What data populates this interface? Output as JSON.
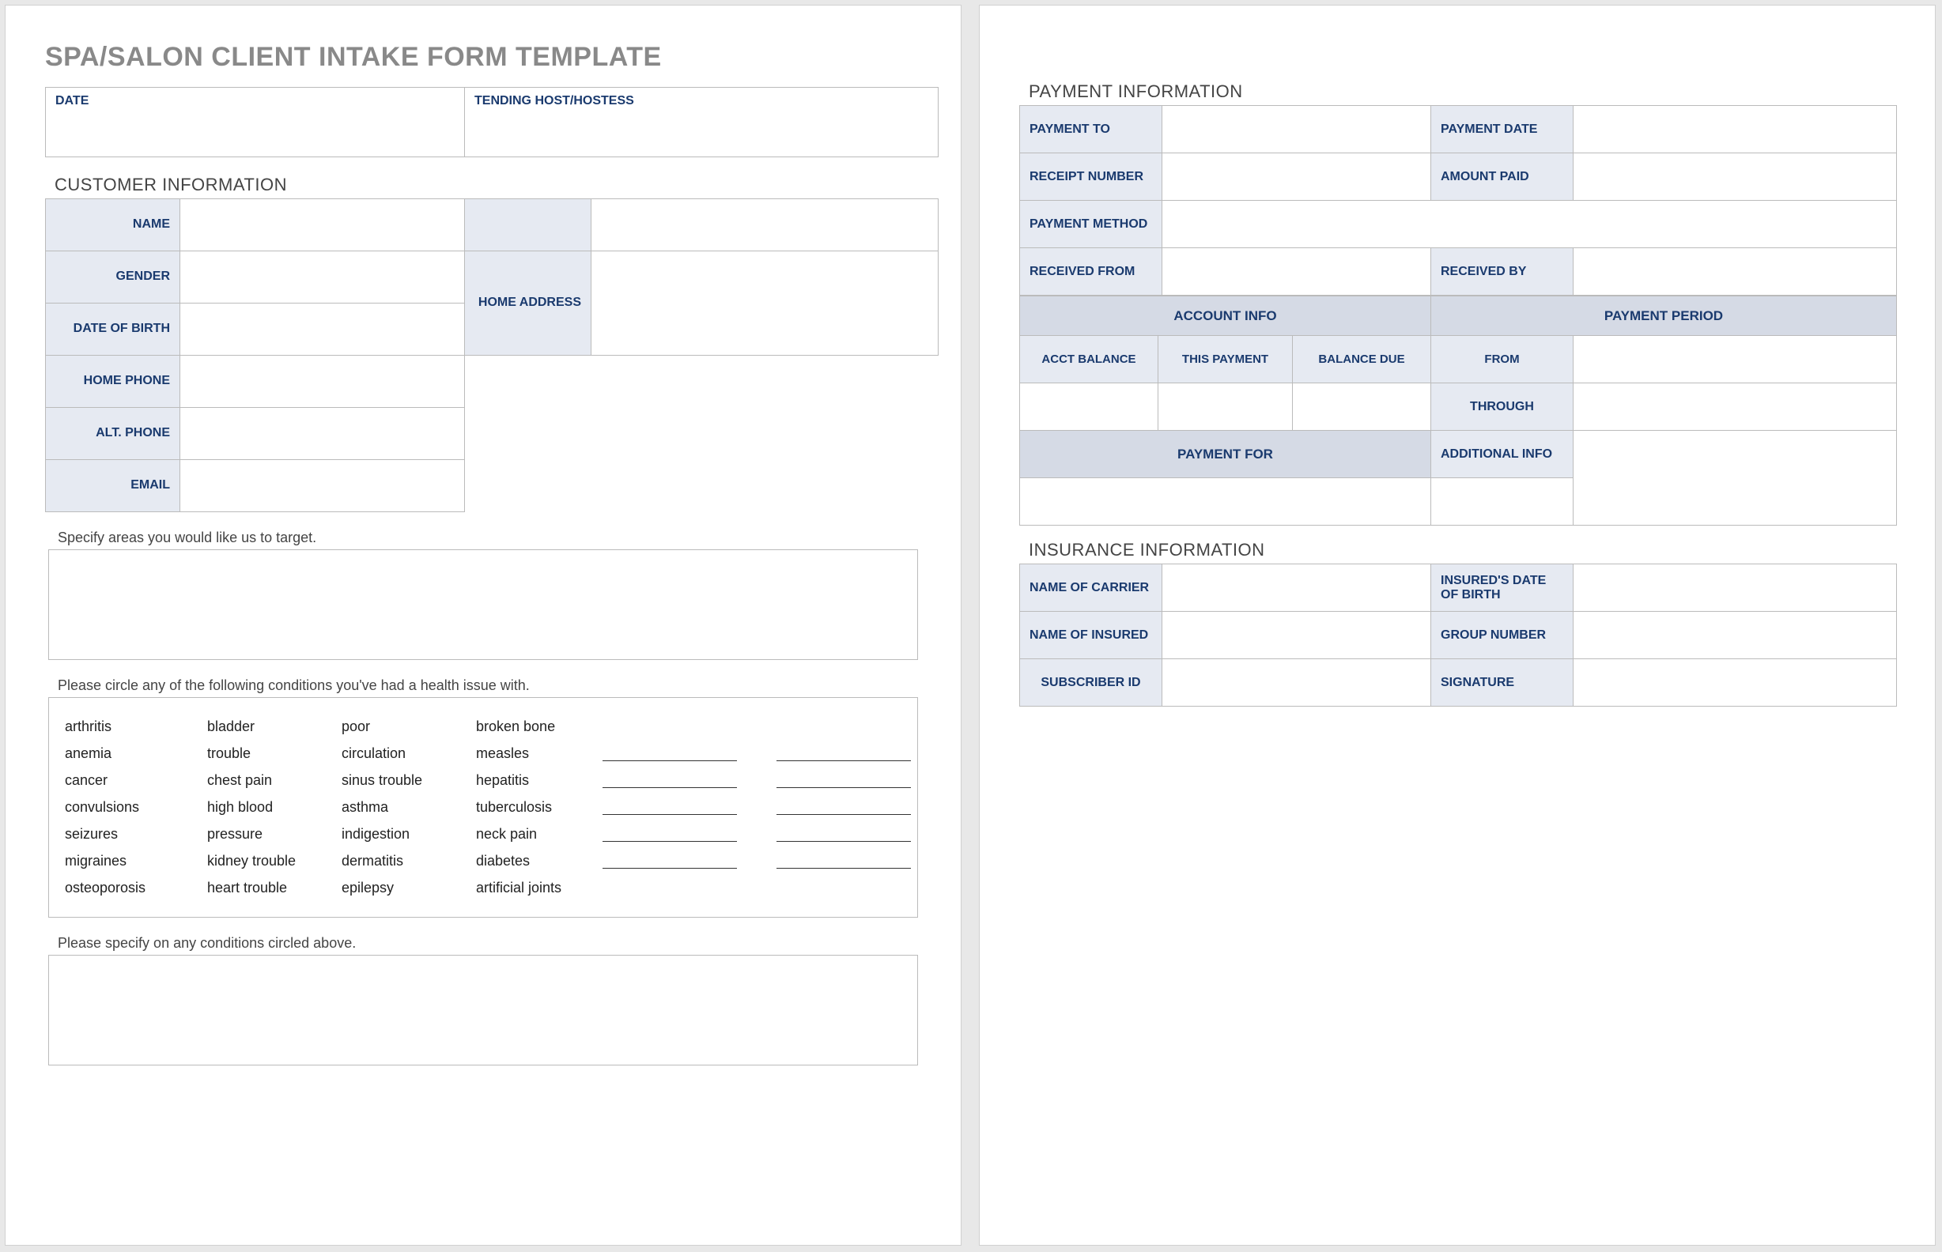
{
  "title": "SPA/SALON CLIENT INTAKE FORM TEMPLATE",
  "header": {
    "date": "DATE",
    "host": "TENDING HOST/HOSTESS"
  },
  "customer_heading": "CUSTOMER INFORMATION",
  "customer": {
    "name": "NAME",
    "gender": "GENDER",
    "dob": "DATE OF BIRTH",
    "home_phone": "HOME PHONE",
    "alt_phone": "ALT. PHONE",
    "email": "EMAIL",
    "home_address": "HOME ADDRESS"
  },
  "notes": {
    "target": "Specify areas you would like us to target.",
    "circle": "Please circle any of the following conditions you've had a health issue with.",
    "specify": "Please specify on any conditions circled above."
  },
  "conditions": {
    "c0": [
      "arthritis",
      "anemia",
      "cancer",
      "convulsions",
      "seizures",
      "migraines",
      "osteoporosis"
    ],
    "c1": [
      "bladder trouble",
      "chest pain",
      "high blood pressure",
      "kidney trouble",
      "heart trouble"
    ],
    "c2": [
      "poor circulation",
      "sinus trouble",
      "asthma",
      "indigestion",
      "dermatitis",
      "epilepsy"
    ],
    "c3": [
      "broken bone",
      "measles",
      "hepatitis",
      "tuberculosis",
      "neck pain",
      "diabetes",
      "artificial joints"
    ]
  },
  "payment_heading": "PAYMENT INFORMATION",
  "payment": {
    "to": "PAYMENT TO",
    "date": "PAYMENT DATE",
    "receipt": "RECEIPT NUMBER",
    "amount": "AMOUNT PAID",
    "method": "PAYMENT METHOD",
    "received_from": "RECEIVED FROM",
    "received_by": "RECEIVED BY",
    "account_info": "ACCOUNT INFO",
    "period": "PAYMENT PERIOD",
    "acct_balance": "ACCT BALANCE",
    "this_payment": "THIS PAYMENT",
    "balance_due": "BALANCE DUE",
    "from": "FROM",
    "through": "THROUGH",
    "payment_for": "PAYMENT FOR",
    "additional": "ADDITIONAL INFO"
  },
  "insurance_heading": "INSURANCE INFORMATION",
  "insurance": {
    "carrier": "NAME OF CARRIER",
    "insured_dob": "INSURED'S DATE OF BIRTH",
    "insured_name": "NAME OF INSURED",
    "group": "GROUP NUMBER",
    "subscriber": "SUBSCRIBER ID",
    "signature": "SIGNATURE"
  }
}
